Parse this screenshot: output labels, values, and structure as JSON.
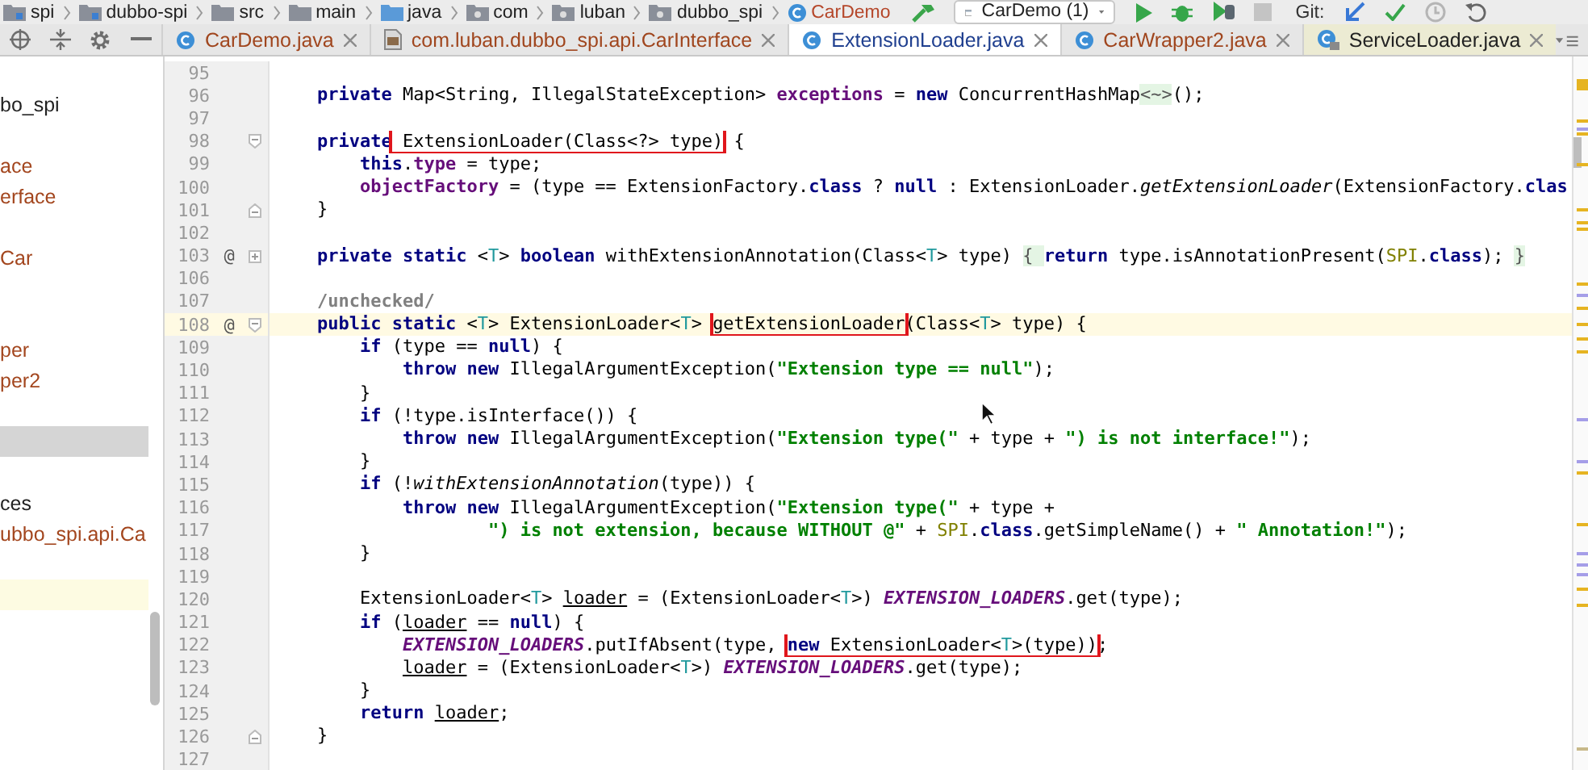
{
  "breadcrumbs": [
    {
      "label": "spi",
      "kind": "module"
    },
    {
      "label": "dubbo-spi",
      "kind": "module"
    },
    {
      "label": "src",
      "kind": "folder"
    },
    {
      "label": "main",
      "kind": "folder"
    },
    {
      "label": "java",
      "kind": "source"
    },
    {
      "label": "com",
      "kind": "package"
    },
    {
      "label": "luban",
      "kind": "package"
    },
    {
      "label": "dubbo_spi",
      "kind": "package"
    },
    {
      "label": "CarDemo",
      "kind": "class"
    }
  ],
  "toolbar": {
    "run_config": "CarDemo (1)",
    "vcs_label": "Git:"
  },
  "tabs": [
    {
      "label": "CarDemo.java",
      "kind": "class",
      "color": "#a0461e",
      "selected": false
    },
    {
      "label": "com.luban.dubbo_spi.api.CarInterface",
      "kind": "interface",
      "color": "#a0461e",
      "selected": false
    },
    {
      "label": "ExtensionLoader.java",
      "kind": "library",
      "color": "#1f3f8f",
      "selected": true
    },
    {
      "label": "CarWrapper2.java",
      "kind": "class",
      "color": "#a0461e",
      "selected": false
    },
    {
      "label": "ServiceLoader.java",
      "kind": "compiled",
      "color": "#222222",
      "selected": false
    }
  ],
  "project_tree": [
    {
      "kind": "empty",
      "selected": false
    },
    {
      "label": "bo_spi",
      "kind": "folder",
      "selected": false
    },
    {
      "kind": "empty",
      "selected": false
    },
    {
      "label": "ace",
      "kind": "file",
      "selected": false
    },
    {
      "label": "erface",
      "kind": "file",
      "selected": false
    },
    {
      "kind": "empty",
      "selected": false
    },
    {
      "label": "Car",
      "kind": "file",
      "selected": false
    },
    {
      "kind": "empty",
      "selected": false
    },
    {
      "kind": "empty",
      "selected": false
    },
    {
      "label": "per",
      "kind": "file",
      "selected": false
    },
    {
      "label": "per2",
      "kind": "file",
      "selected": false
    },
    {
      "kind": "empty",
      "selected": false
    },
    {
      "kind": "empty",
      "selected": true
    },
    {
      "kind": "empty",
      "selected": false
    },
    {
      "label": "ces",
      "kind": "folder",
      "selected": false
    },
    {
      "label": "ubbo_spi.api.Ca",
      "kind": "file",
      "selected": false
    },
    {
      "kind": "empty",
      "selected": false
    },
    {
      "kind": "marked",
      "selected": false
    }
  ],
  "editor": {
    "lines": [
      {
        "number": "95"
      },
      {
        "number": "96",
        "tokens": [
          {
            "text": "    private",
            "kind": "kw"
          },
          {
            "text": " Map<String, IllegalStateException> ",
            "kind": "plain"
          },
          {
            "text": "exceptions",
            "kind": "field"
          },
          {
            "text": " = ",
            "kind": "plain"
          },
          {
            "text": "new",
            "kind": "kw"
          },
          {
            "text": " ConcurrentHashMap",
            "kind": "plain"
          },
          {
            "text": "<~>",
            "kind": "folded"
          },
          {
            "text": "();",
            "kind": "plain"
          }
        ]
      },
      {
        "number": "97"
      },
      {
        "number": "98",
        "fold": {
          "kind": "start"
        },
        "tokens": [
          {
            "text": "    private",
            "kind": "kw"
          },
          {
            "kind": "box",
            "tokens": [
              {
                "text": " ExtensionLoader(Class<?> type)",
                "kind": "plain"
              }
            ]
          },
          {
            "text": " {",
            "kind": "plain"
          }
        ]
      },
      {
        "number": "99",
        "tokens": [
          {
            "text": "        this",
            "kind": "kw"
          },
          {
            "text": ".",
            "kind": "plain"
          },
          {
            "text": "type",
            "kind": "field"
          },
          {
            "text": " = type;",
            "kind": "plain"
          }
        ]
      },
      {
        "number": "100",
        "tokens": [
          {
            "text": "        objectFactory",
            "kind": "field"
          },
          {
            "text": " = (type == ExtensionFactory.",
            "kind": "plain"
          },
          {
            "text": "class",
            "kind": "kw"
          },
          {
            "text": " ? ",
            "kind": "plain"
          },
          {
            "text": "null",
            "kind": "kw"
          },
          {
            "text": " : ExtensionLoader.",
            "kind": "plain"
          },
          {
            "text": "getExtensionLoader",
            "kind": "italic"
          },
          {
            "text": "(ExtensionFactory.",
            "kind": "plain"
          },
          {
            "text": "clas",
            "kind": "kw"
          }
        ]
      },
      {
        "number": "101",
        "fold": {
          "kind": "end"
        },
        "tokens": [
          {
            "text": "    }",
            "kind": "plain"
          }
        ]
      },
      {
        "number": "102"
      },
      {
        "number": "103",
        "mark": "@",
        "fold": {
          "kind": "collapsed"
        },
        "tokens": [
          {
            "text": "    private static",
            "kind": "kw"
          },
          {
            "text": " <",
            "kind": "plain"
          },
          {
            "text": "T",
            "kind": "generic"
          },
          {
            "text": "> ",
            "kind": "plain"
          },
          {
            "text": "boolean",
            "kind": "kw"
          },
          {
            "text": " withExtensionAnnotation(Class<",
            "kind": "plain"
          },
          {
            "text": "T",
            "kind": "generic"
          },
          {
            "text": "> type) ",
            "kind": "plain"
          },
          {
            "text": "{ ",
            "kind": "folded"
          },
          {
            "text": "return",
            "kind": "kw"
          },
          {
            "text": " type.isAnnotationPresent(",
            "kind": "plain"
          },
          {
            "text": "SPI",
            "kind": "annotation"
          },
          {
            "text": ".",
            "kind": "plain"
          },
          {
            "text": "class",
            "kind": "kw"
          },
          {
            "text": "); ",
            "kind": "plain"
          },
          {
            "text": "}",
            "kind": "folded"
          }
        ]
      },
      {
        "number": "106"
      },
      {
        "number": "107",
        "tokens": [
          {
            "text": "    /unchecked/",
            "kind": "comment"
          }
        ]
      },
      {
        "number": "108",
        "mark": "@",
        "fold": {
          "kind": "start"
        },
        "current": true,
        "tokens": [
          {
            "text": "    public static",
            "kind": "kw"
          },
          {
            "text": " <",
            "kind": "plain"
          },
          {
            "text": "T",
            "kind": "generic"
          },
          {
            "text": "> ExtensionLoader<",
            "kind": "plain"
          },
          {
            "text": "T",
            "kind": "generic"
          },
          {
            "text": "> ",
            "kind": "plain"
          },
          {
            "kind": "box",
            "tokens": [
              {
                "text": "getExtensionLoader",
                "kind": "plain"
              }
            ]
          },
          {
            "text": "(Class<",
            "kind": "plain"
          },
          {
            "text": "T",
            "kind": "generic"
          },
          {
            "text": "> type) {",
            "kind": "plain"
          }
        ]
      },
      {
        "number": "109",
        "tokens": [
          {
            "text": "        if",
            "kind": "kw"
          },
          {
            "text": " (type == ",
            "kind": "plain"
          },
          {
            "text": "null",
            "kind": "kw"
          },
          {
            "text": ") {",
            "kind": "plain"
          }
        ]
      },
      {
        "number": "110",
        "tokens": [
          {
            "text": "            throw new",
            "kind": "kw"
          },
          {
            "text": " IllegalArgumentException(",
            "kind": "plain"
          },
          {
            "text": "\"Extension type == null\"",
            "kind": "string"
          },
          {
            "text": ");",
            "kind": "plain"
          }
        ]
      },
      {
        "number": "111",
        "tokens": [
          {
            "text": "        }",
            "kind": "plain"
          }
        ]
      },
      {
        "number": "112",
        "tokens": [
          {
            "text": "        if",
            "kind": "kw"
          },
          {
            "text": " (!type.isInterface()) {",
            "kind": "plain"
          }
        ]
      },
      {
        "number": "113",
        "tokens": [
          {
            "text": "            throw new",
            "kind": "kw"
          },
          {
            "text": " IllegalArgumentException(",
            "kind": "plain"
          },
          {
            "text": "\"Extension type(\"",
            "kind": "string"
          },
          {
            "text": " + type + ",
            "kind": "plain"
          },
          {
            "text": "\") is not interface!\"",
            "kind": "string"
          },
          {
            "text": ");",
            "kind": "plain"
          }
        ]
      },
      {
        "number": "114",
        "tokens": [
          {
            "text": "        }",
            "kind": "plain"
          }
        ]
      },
      {
        "number": "115",
        "tokens": [
          {
            "text": "        if",
            "kind": "kw"
          },
          {
            "text": " (!",
            "kind": "plain"
          },
          {
            "text": "withExtensionAnnotation",
            "kind": "italic"
          },
          {
            "text": "(type)) {",
            "kind": "plain"
          }
        ]
      },
      {
        "number": "116",
        "tokens": [
          {
            "text": "            throw new",
            "kind": "kw"
          },
          {
            "text": " IllegalArgumentException(",
            "kind": "plain"
          },
          {
            "text": "\"Extension type(\"",
            "kind": "string"
          },
          {
            "text": " + type +",
            "kind": "plain"
          }
        ]
      },
      {
        "number": "117",
        "tokens": [
          {
            "text": "                    \") is not extension, because WITHOUT @\"",
            "kind": "string"
          },
          {
            "text": " + ",
            "kind": "plain"
          },
          {
            "text": "SPI",
            "kind": "annotation"
          },
          {
            "text": ".",
            "kind": "plain"
          },
          {
            "text": "class",
            "kind": "kw"
          },
          {
            "text": ".getSimpleName() + ",
            "kind": "plain"
          },
          {
            "text": "\" Annotation!\"",
            "kind": "string"
          },
          {
            "text": ");",
            "kind": "plain"
          }
        ]
      },
      {
        "number": "118",
        "tokens": [
          {
            "text": "        }",
            "kind": "plain"
          }
        ]
      },
      {
        "number": "119"
      },
      {
        "number": "120",
        "tokens": [
          {
            "text": "        ExtensionLoader<",
            "kind": "plain"
          },
          {
            "text": "T",
            "kind": "generic"
          },
          {
            "text": "> ",
            "kind": "plain"
          },
          {
            "text": "loader",
            "kind": "underlined"
          },
          {
            "text": " = (ExtensionLoader<",
            "kind": "plain"
          },
          {
            "text": "T",
            "kind": "generic"
          },
          {
            "text": ">) ",
            "kind": "plain"
          },
          {
            "text": "EXTENSION_LOADERS",
            "kind": "static"
          },
          {
            "text": ".get(type);",
            "kind": "plain"
          }
        ]
      },
      {
        "number": "121",
        "tokens": [
          {
            "text": "        if",
            "kind": "kw"
          },
          {
            "text": " (",
            "kind": "plain"
          },
          {
            "text": "loader",
            "kind": "underlined"
          },
          {
            "text": " == ",
            "kind": "plain"
          },
          {
            "text": "null",
            "kind": "kw"
          },
          {
            "text": ") {",
            "kind": "plain"
          }
        ]
      },
      {
        "number": "122",
        "tokens": [
          {
            "text": "            EXTENSION_LOADERS",
            "kind": "static"
          },
          {
            "text": ".putIfAbsent(type, ",
            "kind": "plain"
          },
          {
            "kind": "box",
            "tokens": [
              {
                "text": "new",
                "kind": "kw"
              },
              {
                "text": " ExtensionLoader<",
                "kind": "plain"
              },
              {
                "text": "T",
                "kind": "generic"
              },
              {
                "text": ">(type))",
                "kind": "plain"
              }
            ]
          },
          {
            "text": ";",
            "kind": "plain"
          }
        ]
      },
      {
        "number": "123",
        "tokens": [
          {
            "text": "            loader",
            "kind": "underlined"
          },
          {
            "text": " = (ExtensionLoader<",
            "kind": "plain"
          },
          {
            "text": "T",
            "kind": "generic"
          },
          {
            "text": ">) ",
            "kind": "plain"
          },
          {
            "text": "EXTENSION_LOADERS",
            "kind": "static"
          },
          {
            "text": ".get(type);",
            "kind": "plain"
          }
        ]
      },
      {
        "number": "124",
        "tokens": [
          {
            "text": "        }",
            "kind": "plain"
          }
        ]
      },
      {
        "number": "125",
        "tokens": [
          {
            "text": "        return ",
            "kind": "kw"
          },
          {
            "text": "loader",
            "kind": "underlined"
          },
          {
            "text": ";",
            "kind": "plain"
          }
        ]
      },
      {
        "number": "126",
        "fold": {
          "kind": "end"
        },
        "tokens": [
          {
            "text": "    }",
            "kind": "plain"
          }
        ]
      },
      {
        "number": "127"
      }
    ]
  }
}
